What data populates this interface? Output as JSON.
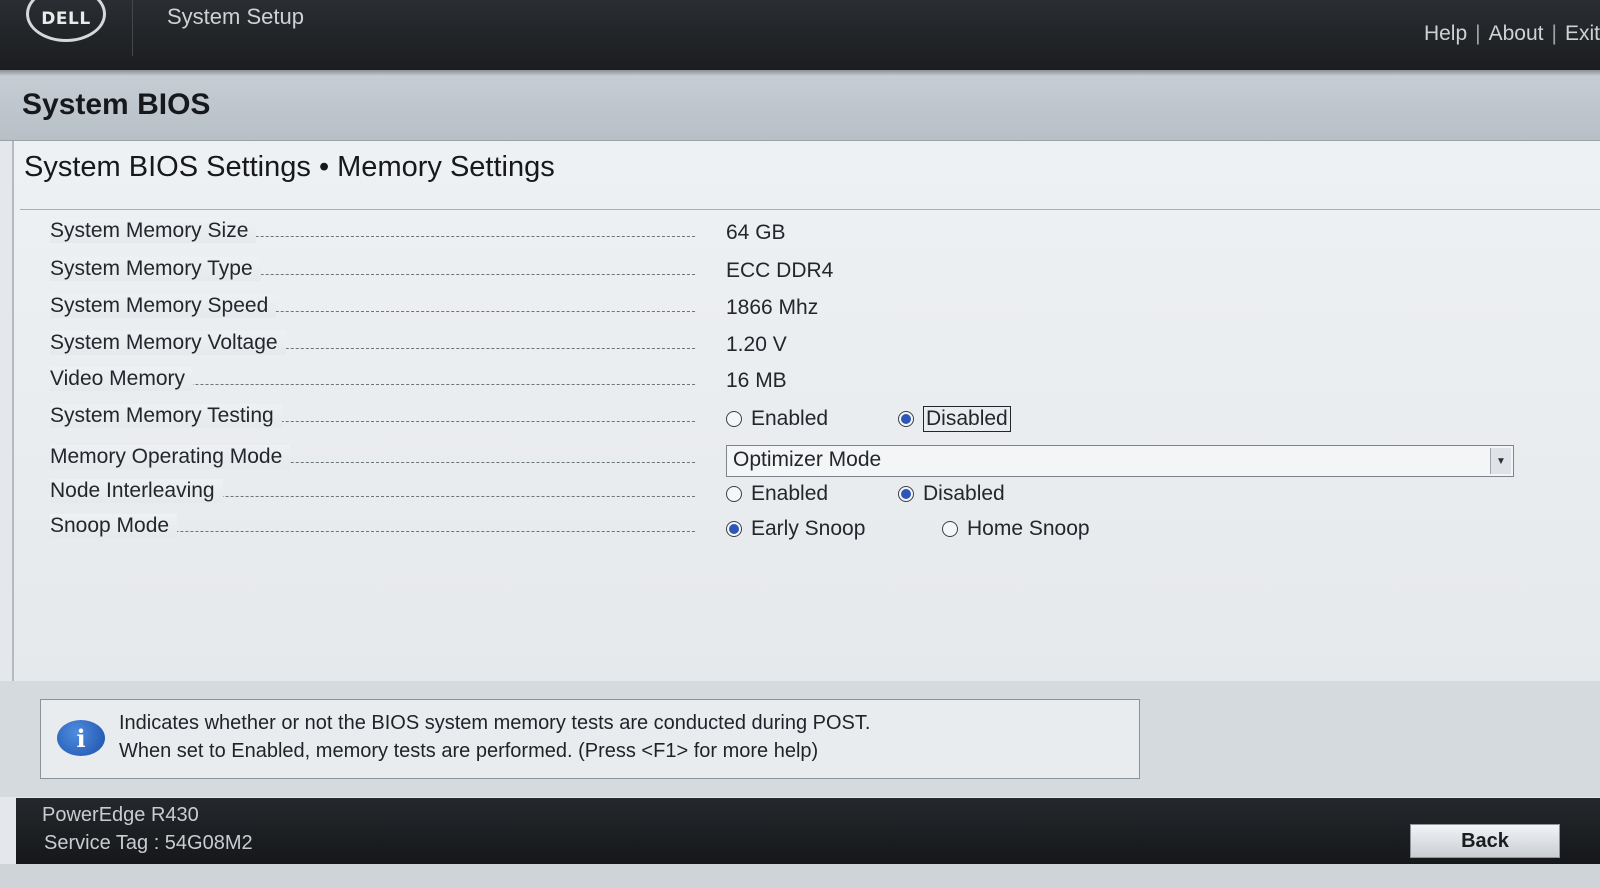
{
  "header": {
    "logo_text": "DELL",
    "app_title": "System Setup",
    "links": [
      "Help",
      "About",
      "Exit"
    ]
  },
  "section": {
    "title": "System BIOS"
  },
  "page": {
    "title": "System BIOS Settings • Memory Settings"
  },
  "settings": {
    "memory_size": {
      "label": "System Memory Size",
      "value": "64 GB"
    },
    "memory_type": {
      "label": "System Memory Type",
      "value": "ECC DDR4"
    },
    "memory_speed": {
      "label": "System Memory Speed",
      "value": "1866 Mhz"
    },
    "memory_voltage": {
      "label": "System Memory Voltage",
      "value": "1.20 V"
    },
    "video_memory": {
      "label": "Video Memory",
      "value": "16 MB"
    },
    "memory_testing": {
      "label": "System Memory Testing",
      "options": [
        "Enabled",
        "Disabled"
      ],
      "selected": "Disabled"
    },
    "operating_mode": {
      "label": "Memory Operating Mode",
      "value": "Optimizer Mode"
    },
    "node_interleaving": {
      "label": "Node Interleaving",
      "options": [
        "Enabled",
        "Disabled"
      ],
      "selected": "Disabled"
    },
    "snoop_mode": {
      "label": "Snoop Mode",
      "options": [
        "Early Snoop",
        "Home Snoop"
      ],
      "selected": "Early Snoop"
    }
  },
  "help": {
    "line1": "Indicates whether or not the BIOS system memory tests are conducted during POST.",
    "line2": "When set to Enabled, memory tests are performed. (Press <F1> for more help)"
  },
  "footer": {
    "model": "PowerEdge R430",
    "service_tag": "Service Tag : 54G08M2",
    "back_label": "Back"
  },
  "colors": {
    "radio_selected": "#2c56b8",
    "topbar": "#1b1d20"
  }
}
